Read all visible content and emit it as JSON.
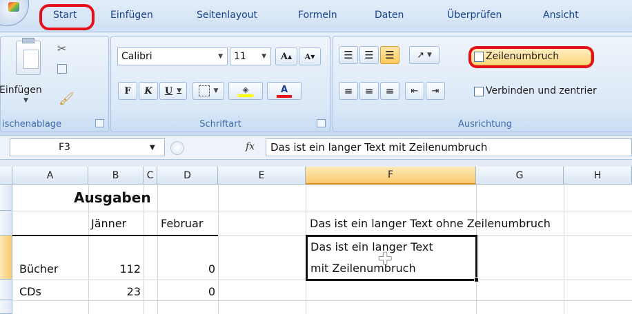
{
  "tabs": [
    "Start",
    "Einfügen",
    "Seitenlayout",
    "Formeln",
    "Daten",
    "Überprüfen",
    "Ansicht"
  ],
  "clipboard": {
    "paste_label": "Einfügen",
    "group_label": "ischenablage"
  },
  "font": {
    "family": "Calibri",
    "size": "11",
    "bold": "F",
    "italic": "K",
    "underline": "U",
    "group_label": "Schriftart"
  },
  "alignment": {
    "wrap_label": "Zeilenumbruch",
    "merge_label": "Verbinden und zentrier",
    "group_label": "Ausrichtung"
  },
  "formula_bar": {
    "name_box": "F3",
    "fx": "fx",
    "content": "Das ist ein langer Text mit Zeilenumbruch"
  },
  "columns": [
    "A",
    "B",
    "C",
    "D",
    "E",
    "F",
    "G",
    "H"
  ],
  "cells": {
    "title": "Ausgaben",
    "jan": "Jänner",
    "feb": "Februar",
    "f2": "Das ist ein langer Text ohne Zeilenumbruch",
    "f3_line1": "Das ist ein langer Text",
    "f3_line2": "mit Zeilenumbruch",
    "row_books": "Bücher",
    "books_jan": "112",
    "books_feb": "0",
    "row_cds": "CDs",
    "cds_jan": "23",
    "cds_feb": "0"
  },
  "colors": {
    "highlight_ring": "#e4101a",
    "selected_col": "#f9d38a",
    "accent": "#15428b"
  }
}
